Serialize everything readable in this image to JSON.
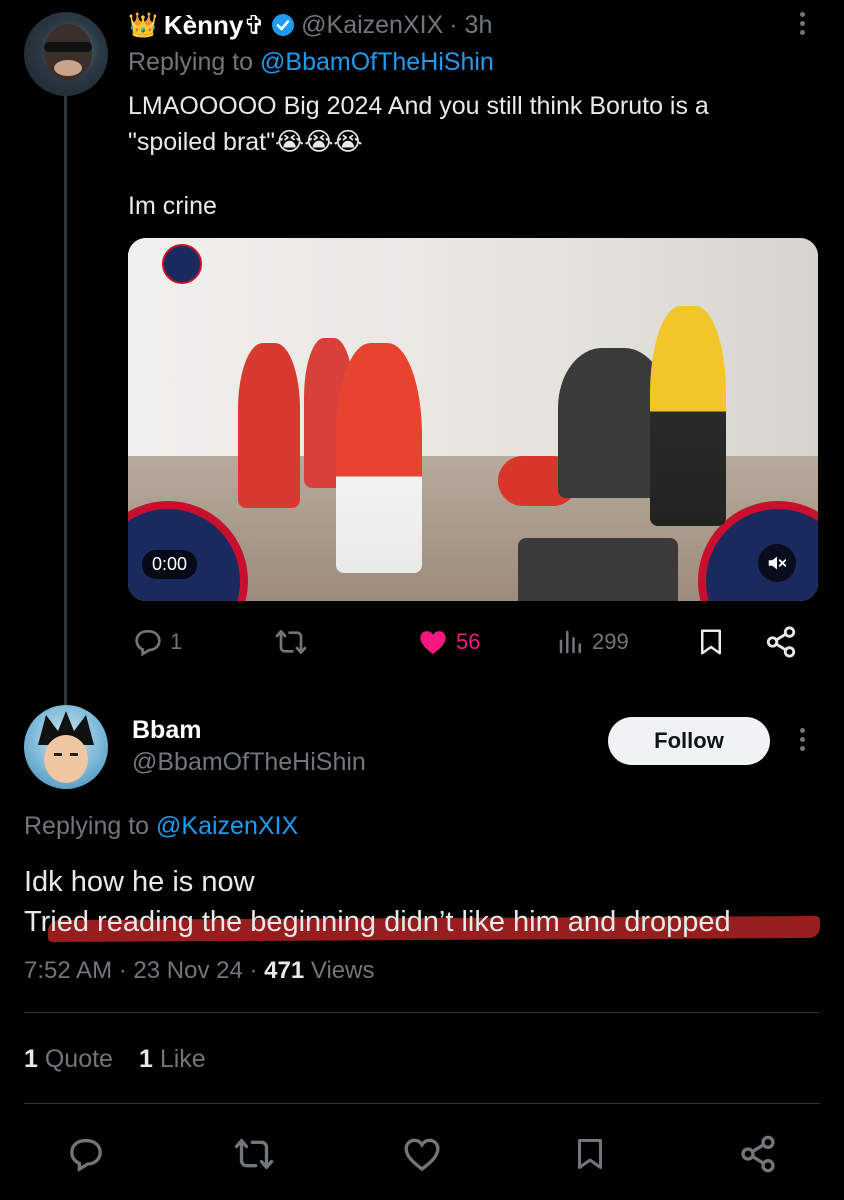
{
  "tweet1": {
    "display_name": "Kènny✞",
    "crown_icon": "👑",
    "handle": "@KaizenXIX",
    "time": "· 3h",
    "replying_prefix": "Replying to",
    "replying_handle": "@BbamOfTheHiShin",
    "text_line1": "LMAOOOOO Big 2024 And you still think Boruto is a",
    "text_line2": "\"spoiled brat\"😭😭😭",
    "text_line3": "Im crine",
    "video_time": "0:00",
    "reply_count": "1",
    "like_count": "56",
    "view_count": "299"
  },
  "tweet2": {
    "display_name": "Bbam",
    "handle": "@BbamOfTheHiShin",
    "follow_label": "Follow",
    "replying_prefix": "Replying to",
    "replying_handle": "@KaizenXIX",
    "text_line1": "Idk how he is now",
    "text_line2": "Tried reading the beginning didn’t like him and dropped",
    "time": "7:52 AM",
    "date": "23 Nov 24",
    "views_count": "471",
    "views_label": "Views",
    "quote_count": "1",
    "quote_label": "Quote",
    "like_count": "1",
    "like_label": "Like"
  },
  "colors": {
    "background": "#000000",
    "link": "#1d9bf0",
    "secondary": "#71767b",
    "like": "#f91880",
    "strike": "#c82828"
  },
  "icons": [
    "verified-badge-icon",
    "more-icon",
    "reply-icon",
    "retweet-icon",
    "heart-icon",
    "views-icon",
    "bookmark-icon",
    "share-icon",
    "mute-icon"
  ]
}
